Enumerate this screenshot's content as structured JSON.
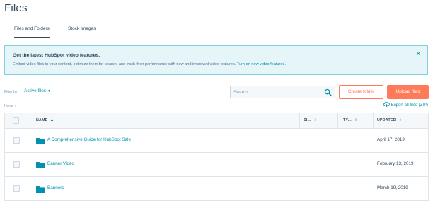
{
  "page": {
    "title": "Files"
  },
  "tabs": [
    {
      "label": "Files and Folders",
      "active": true
    },
    {
      "label": "Stock Images",
      "active": false
    }
  ],
  "banner": {
    "title": "Get the latest HubSpot video features.",
    "text": "Embed video files in your content, optimize them for search, and track their performance with new and improved video features. ",
    "link": "Turn on new video features.",
    "close_icon": "close-icon"
  },
  "filter": {
    "label": "Filter by",
    "value": "Active files"
  },
  "search": {
    "placeholder": "Search",
    "value": ""
  },
  "buttons": {
    "create_folder": "Create folder",
    "upload_files": "Upload files"
  },
  "breadcrumb": {
    "home": "Home"
  },
  "export": {
    "label": "Export all files (ZIP)"
  },
  "table": {
    "columns": {
      "name": "NAME",
      "size": "SI...",
      "type": "TY...",
      "updated": "UPDATED"
    },
    "rows": [
      {
        "name": "A Comprehensive Guide for HubSpot Sale",
        "updated": "April 17, 2019",
        "icon": "folder-icon"
      },
      {
        "name": "Banner Video",
        "updated": "February 13, 2019",
        "icon": "folder-icon"
      },
      {
        "name": "Banners",
        "updated": "March 19, 2019",
        "icon": "folder-icon"
      }
    ]
  },
  "colors": {
    "accent": "#ff7a59",
    "link": "#0091ae",
    "text": "#33475b",
    "banner_bg": "#e5f5f8"
  }
}
